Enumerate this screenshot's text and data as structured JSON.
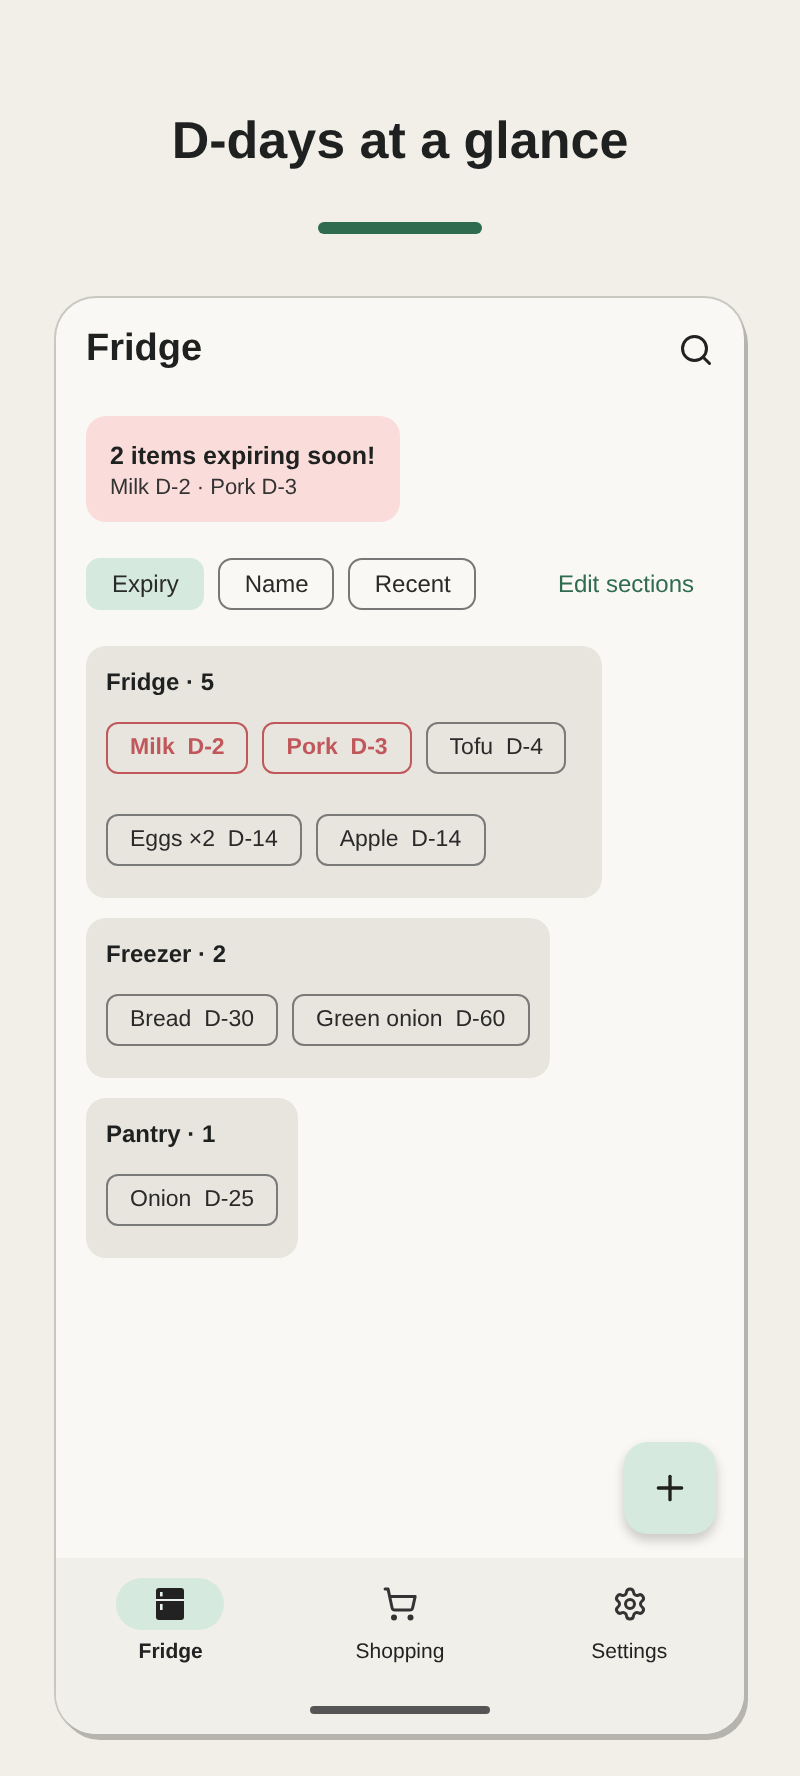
{
  "headline": "D-days at a glance",
  "screen": {
    "title": "Fridge",
    "alert": {
      "title": "2 items expiring soon!",
      "detail": "Milk D-2 · Pork D-3"
    },
    "sort_options": [
      {
        "label": "Expiry",
        "selected": true
      },
      {
        "label": "Name",
        "selected": false
      },
      {
        "label": "Recent",
        "selected": false
      }
    ],
    "edit_link": "Edit sections",
    "sections": [
      {
        "title": "Fridge · 5",
        "items": [
          {
            "name": "Milk",
            "due": "D-2",
            "urgent": true
          },
          {
            "name": "Pork",
            "due": "D-3",
            "urgent": true
          },
          {
            "name": "Tofu",
            "due": "D-4",
            "urgent": false
          },
          {
            "name": "Eggs ×2",
            "due": "D-14",
            "urgent": false
          },
          {
            "name": "Apple",
            "due": "D-14",
            "urgent": false
          }
        ]
      },
      {
        "title": "Freezer · 2",
        "items": [
          {
            "name": "Bread",
            "due": "D-30",
            "urgent": false
          },
          {
            "name": "Green onion",
            "due": "D-60",
            "urgent": false
          }
        ]
      },
      {
        "title": "Pantry · 1",
        "items": [
          {
            "name": "Onion",
            "due": "D-25",
            "urgent": false
          }
        ]
      }
    ],
    "nav": [
      {
        "kind": "fridge",
        "label": "Fridge",
        "selected": true
      },
      {
        "kind": "cart",
        "label": "Shopping",
        "selected": false
      },
      {
        "kind": "gear",
        "label": "Settings",
        "selected": false
      }
    ]
  }
}
